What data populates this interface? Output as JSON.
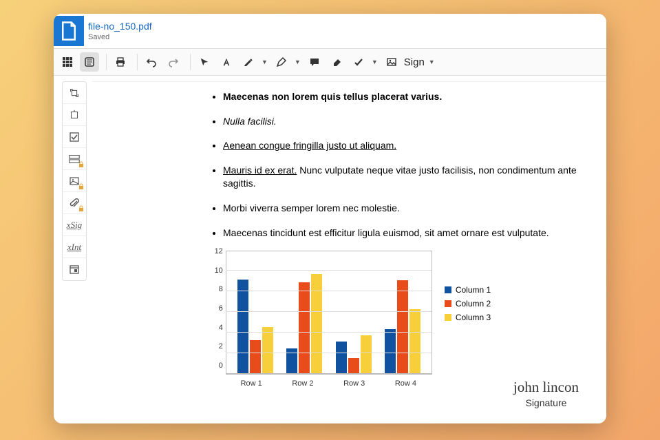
{
  "header": {
    "filename": "file-no_150.pdf",
    "status": "Saved"
  },
  "toolbar": {
    "sign_label": "Sign"
  },
  "doc": {
    "items": [
      {
        "text": "Maecenas non lorem quis tellus placerat varius.",
        "style": "b"
      },
      {
        "text": "Nulla facilisi.",
        "style": "i"
      },
      {
        "text": "Aenean congue fringilla justo ut aliquam.",
        "style": "u",
        "trailing_space": true
      },
      {
        "prefix": "Mauris id ex erat.",
        "prefix_style": "u",
        "rest": " Nunc vulputate neque vitae justo facilisis, non condimentum ante sagittis."
      },
      {
        "text": "Morbi viverra semper lorem nec molestie."
      },
      {
        "text": "Maecenas tincidunt est efficitur ligula euismod, sit amet ornare est vulputate."
      }
    ]
  },
  "chart_data": {
    "type": "bar",
    "categories": [
      "Row 1",
      "Row 2",
      "Row 3",
      "Row 4"
    ],
    "series": [
      {
        "name": "Column 1",
        "color": "#10529f",
        "values": [
          9.1,
          2.4,
          3.1,
          4.3
        ]
      },
      {
        "name": "Column 2",
        "color": "#e84c1a",
        "values": [
          3.2,
          8.8,
          1.5,
          9.0
        ]
      },
      {
        "name": "Column 3",
        "color": "#f6cf3a",
        "values": [
          4.5,
          9.6,
          3.7,
          6.2
        ]
      }
    ],
    "ylim": [
      0,
      12
    ],
    "yticks": [
      0,
      2,
      4,
      6,
      8,
      10,
      12
    ],
    "title": "",
    "xlabel": "",
    "ylabel": ""
  },
  "signature": {
    "name": "john lincon",
    "label": "Signature"
  },
  "side_scripts": {
    "sig": "xSig",
    "int": "xInt"
  }
}
